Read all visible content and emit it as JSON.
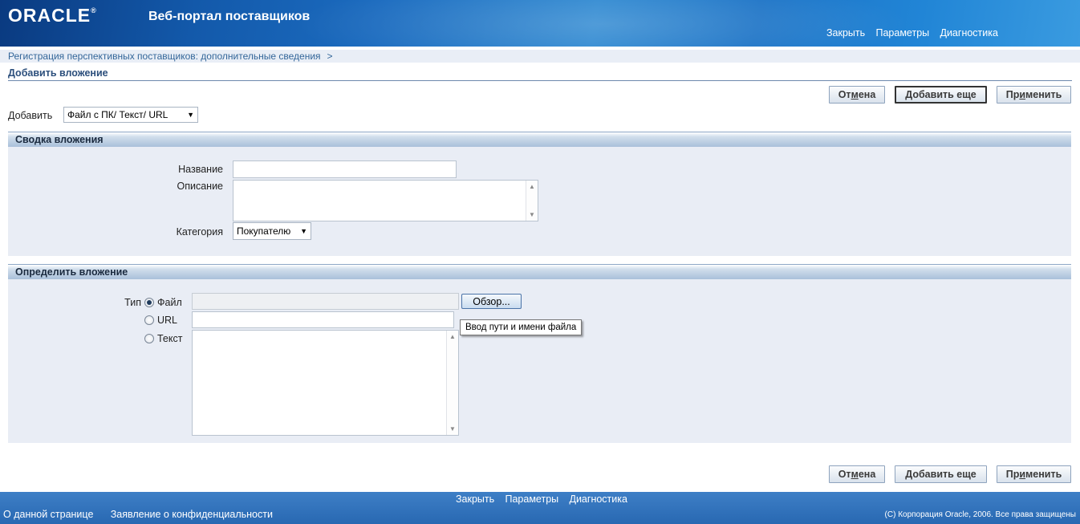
{
  "header": {
    "logo_text": "ORACLE",
    "logo_mark": "®",
    "app_title": "Веб-портал поставщиков",
    "links": [
      "Закрыть",
      "Параметры",
      "Диагностика"
    ]
  },
  "breadcrumb": {
    "items": [
      "Регистрация перспективных поставщиков: дополнительные сведения"
    ],
    "separator": ">"
  },
  "page_title": "Добавить вложение",
  "buttons": {
    "cancel": {
      "pre": "От",
      "accel": "м",
      "post": "ена"
    },
    "add_more": "Добавить еще",
    "apply": {
      "pre": "Пр",
      "accel": "и",
      "post": "менить"
    }
  },
  "add_row": {
    "label": "Добавить",
    "selected": "Файл с ПК/ Текст/ URL"
  },
  "summary_section": {
    "title": "Сводка вложения",
    "name_label": "Название",
    "name_value": "",
    "description_label": "Описание",
    "description_value": "",
    "category_label": "Категория",
    "category_selected": "Покупателю"
  },
  "define_section": {
    "title": "Определить вложение",
    "type_label": "Тип",
    "options": [
      "Файл",
      "URL",
      "Текст"
    ],
    "selected_option": "Файл",
    "browse_label": "Обзор...",
    "tooltip": "Ввод пути и имени файла",
    "url_value": "",
    "text_value": ""
  },
  "footer": {
    "links": [
      "Закрыть",
      "Параметры",
      "Диагностика"
    ],
    "left_links": [
      "О данной странице",
      "Заявление о конфиденциальности"
    ],
    "copyright": "(C) Корпорация Oracle, 2006. Все права защищены"
  },
  "colors": {
    "header_blue": "#1b6bbf",
    "section_bg": "#e9edf5",
    "link_blue": "#336699",
    "title_blue": "#2c4f7c"
  }
}
